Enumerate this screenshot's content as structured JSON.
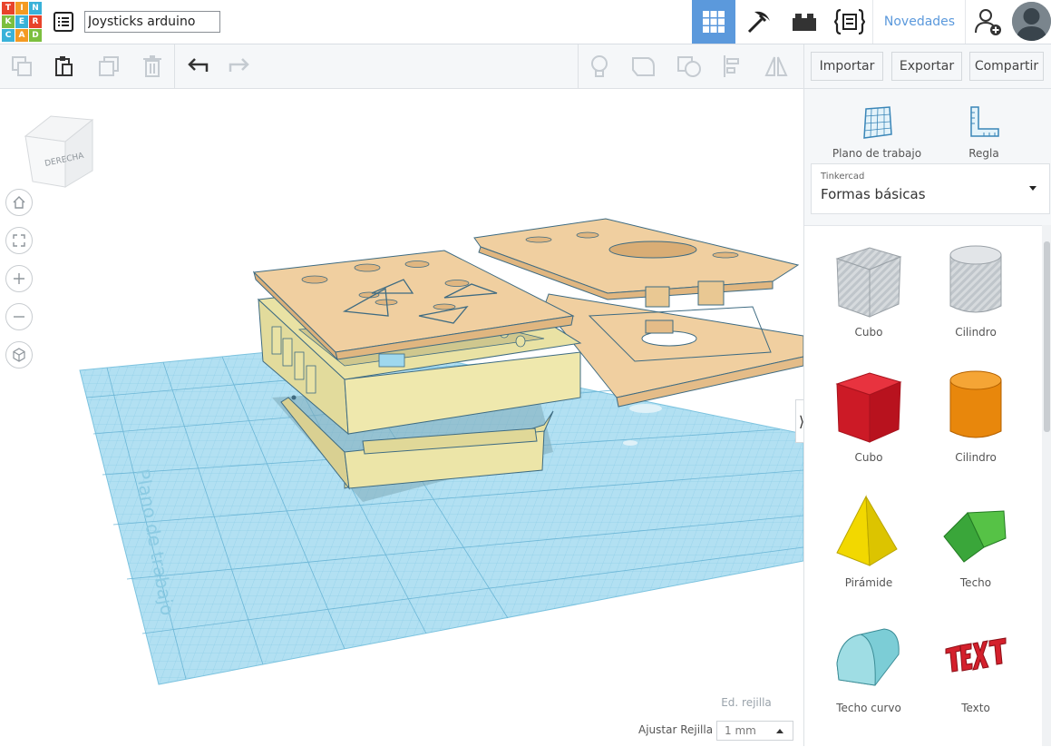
{
  "logo": {
    "letters": [
      "T",
      "I",
      "N",
      "K",
      "E",
      "R",
      "C",
      "A",
      "D"
    ]
  },
  "project": {
    "title": "Joysticks arduino"
  },
  "header": {
    "novedades": "Novedades"
  },
  "toolbar": {
    "import": "Importar",
    "export": "Exportar",
    "share": "Compartir"
  },
  "viewcube": {
    "face": "DERECHA"
  },
  "workplane_text": "Plano de trabajo",
  "sidebar": {
    "workplane": "Plano de trabajo",
    "ruler": "Regla",
    "library_category": "Tinkercad",
    "library_value": "Formas básicas",
    "shapes": [
      {
        "label": "Cubo",
        "color": "#c6cbd0"
      },
      {
        "label": "Cilindro",
        "color": "#c6cbd0"
      },
      {
        "label": "Cubo",
        "color": "#d4202c"
      },
      {
        "label": "Cilindro",
        "color": "#e8870c"
      },
      {
        "label": "Pirámide",
        "color": "#f2d800"
      },
      {
        "label": "Techo",
        "color": "#3aa63a"
      },
      {
        "label": "Techo curvo",
        "color": "#7ccdd6"
      },
      {
        "label": "Texto",
        "color": "#d4202c"
      }
    ]
  },
  "grid": {
    "edit": "Ed. rejilla",
    "snap_label": "Ajustar Rejilla",
    "snap_value": "1 mm"
  },
  "colors": {
    "accent": "#5b99dc",
    "workplane": "#a9dbef",
    "model": "#f0cfa0",
    "box": "#ede6a8"
  }
}
